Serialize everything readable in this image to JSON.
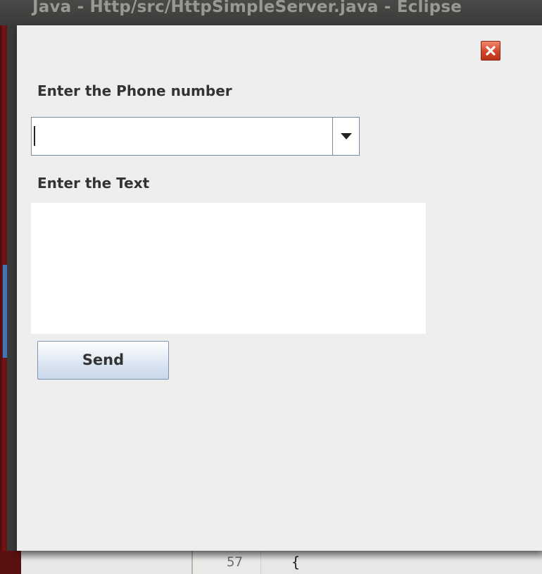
{
  "background_window": {
    "title": "Java - Http/src/HttpSimpleServer.java - Eclipse",
    "line_number": "57",
    "code_text": "{"
  },
  "dialog": {
    "phone_label": "Enter the Phone number",
    "phone_value": "",
    "text_label": "Enter the Text",
    "text_value": "",
    "send_label": "Send"
  },
  "colors": {
    "dialog_bg": "#eeeeee",
    "close_button": "#d2462a",
    "eclipse_red": "#7a1616"
  },
  "icons": {
    "close": "close-icon",
    "dropdown": "chevron-down-icon"
  }
}
